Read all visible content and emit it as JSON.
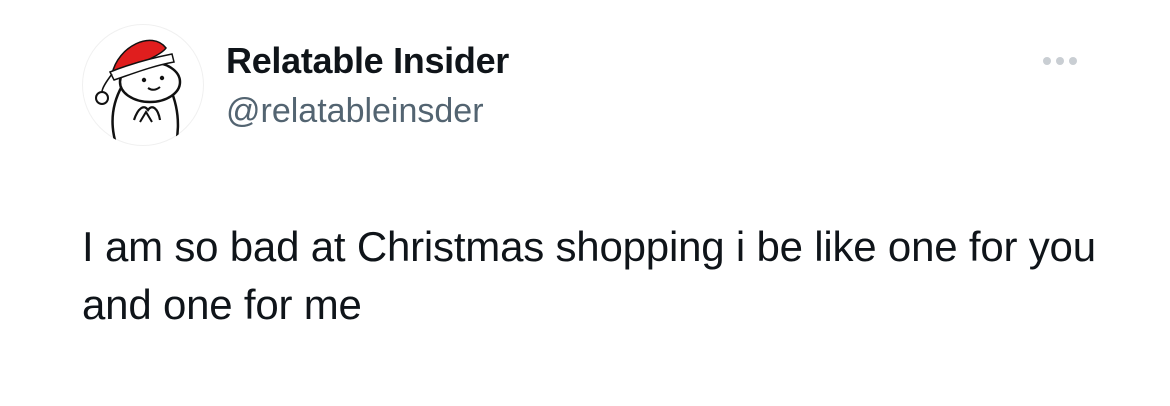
{
  "tweet": {
    "author": {
      "display_name": "Relatable Insider",
      "handle": "@relatableinsder",
      "avatar_icon": "cartoon-santa-hat-avatar"
    },
    "more_icon": "more-horizontal-icon",
    "text": "I am so bad at Christmas shopping i be like one for you and one for me"
  },
  "colors": {
    "text_primary": "#0f1419",
    "text_secondary": "#536471",
    "hat_red": "#e01e1e",
    "background": "#ffffff"
  }
}
